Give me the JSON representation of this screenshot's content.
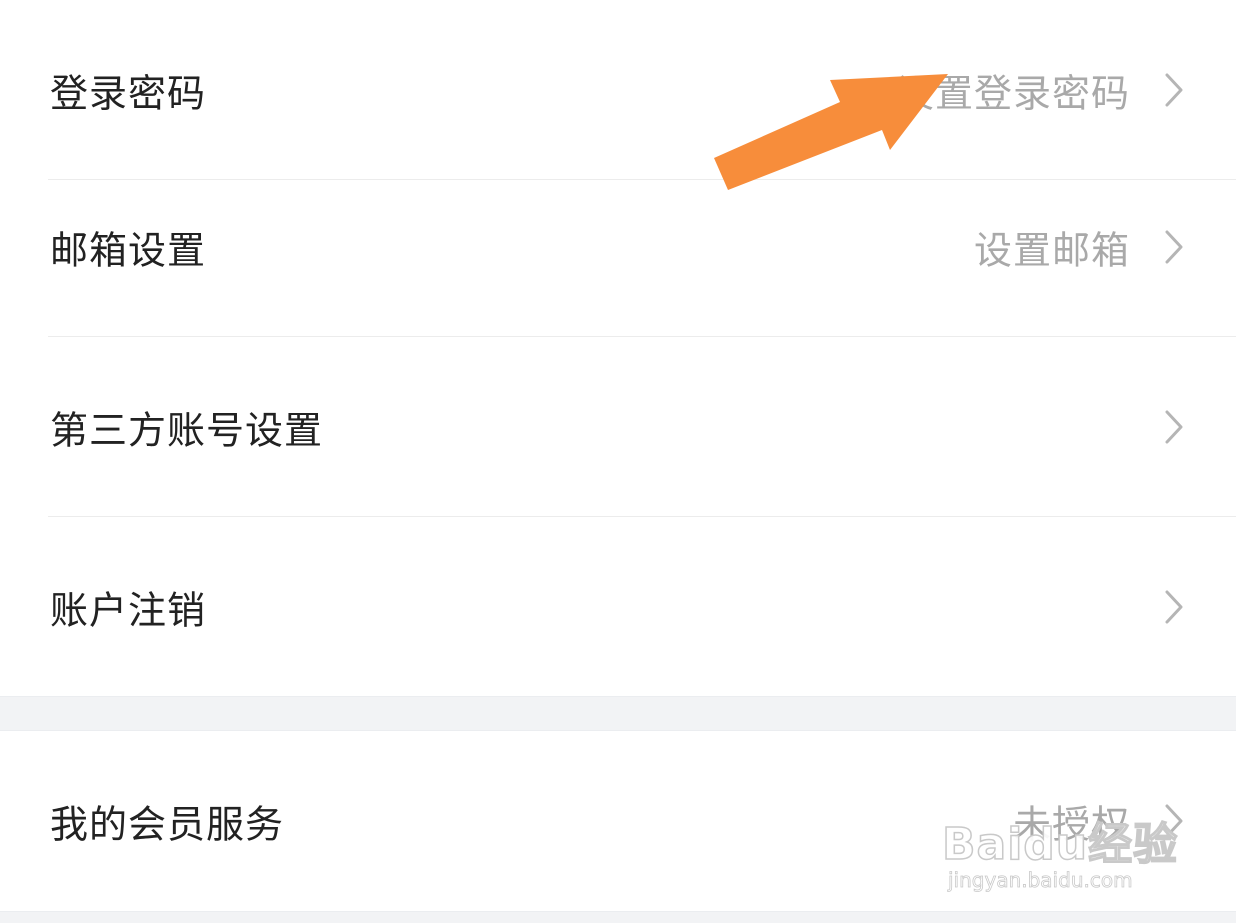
{
  "settings_group_1": {
    "rows": [
      {
        "label": "登录密码",
        "value": "设置登录密码"
      },
      {
        "label": "邮箱设置",
        "value": "设置邮箱"
      },
      {
        "label": "第三方账号设置",
        "value": ""
      },
      {
        "label": "账户注销",
        "value": ""
      }
    ]
  },
  "settings_group_2": {
    "rows": [
      {
        "label": "我的会员服务",
        "value": "未授权"
      }
    ]
  },
  "icons": {
    "row_chevron": "chevron-right-icon",
    "annotation": "arrow-annotation-icon"
  },
  "watermark": {
    "brand": "Baidu经验",
    "url": "jingyan.baidu.com"
  },
  "colors": {
    "background": "#ffffff",
    "section_gap": "#f2f3f5",
    "divider": "#ececec",
    "label_text": "#222222",
    "value_text": "#a9a9a9",
    "chevron": "#b5b5b5",
    "arrow": "#f78d3b"
  }
}
